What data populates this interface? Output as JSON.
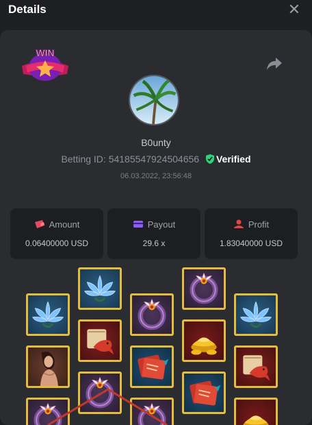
{
  "header": {
    "title": "Details"
  },
  "icons": {
    "close": "close-icon",
    "share": "share-icon",
    "win_badge": "win-badge-icon",
    "verified": "shield-check-icon"
  },
  "badge": {
    "text": "WIN"
  },
  "player": {
    "username": "B0unty",
    "betting_id_label": "Betting ID:",
    "betting_id": "54185547924504656",
    "verified_label": "Verified",
    "datetime": "06.03.2022, 23:56:48"
  },
  "stats": {
    "amount": {
      "label": "Amount",
      "value": "0.06400000 USD",
      "icon": "wallet-icon"
    },
    "payout": {
      "label": "Payout",
      "value": "29.6 x",
      "icon": "card-icon"
    },
    "profit": {
      "label": "Profit",
      "value": "1.83040000 USD",
      "icon": "profit-icon"
    }
  },
  "colors": {
    "accent_green": "#2bd37a",
    "tile_border": "#e3bd3b",
    "amount_icon": "#e8495c",
    "payout_icon": "#8b5cf6",
    "profit_icon": "#e84343"
  },
  "reels": [
    [
      "lotus",
      "lady",
      "ring"
    ],
    [
      "lotus",
      "koi",
      "ring"
    ],
    [
      "ring",
      "card",
      "ring"
    ],
    [
      "ring",
      "gold",
      "card"
    ],
    [
      "lotus",
      "koi",
      "gold"
    ]
  ]
}
